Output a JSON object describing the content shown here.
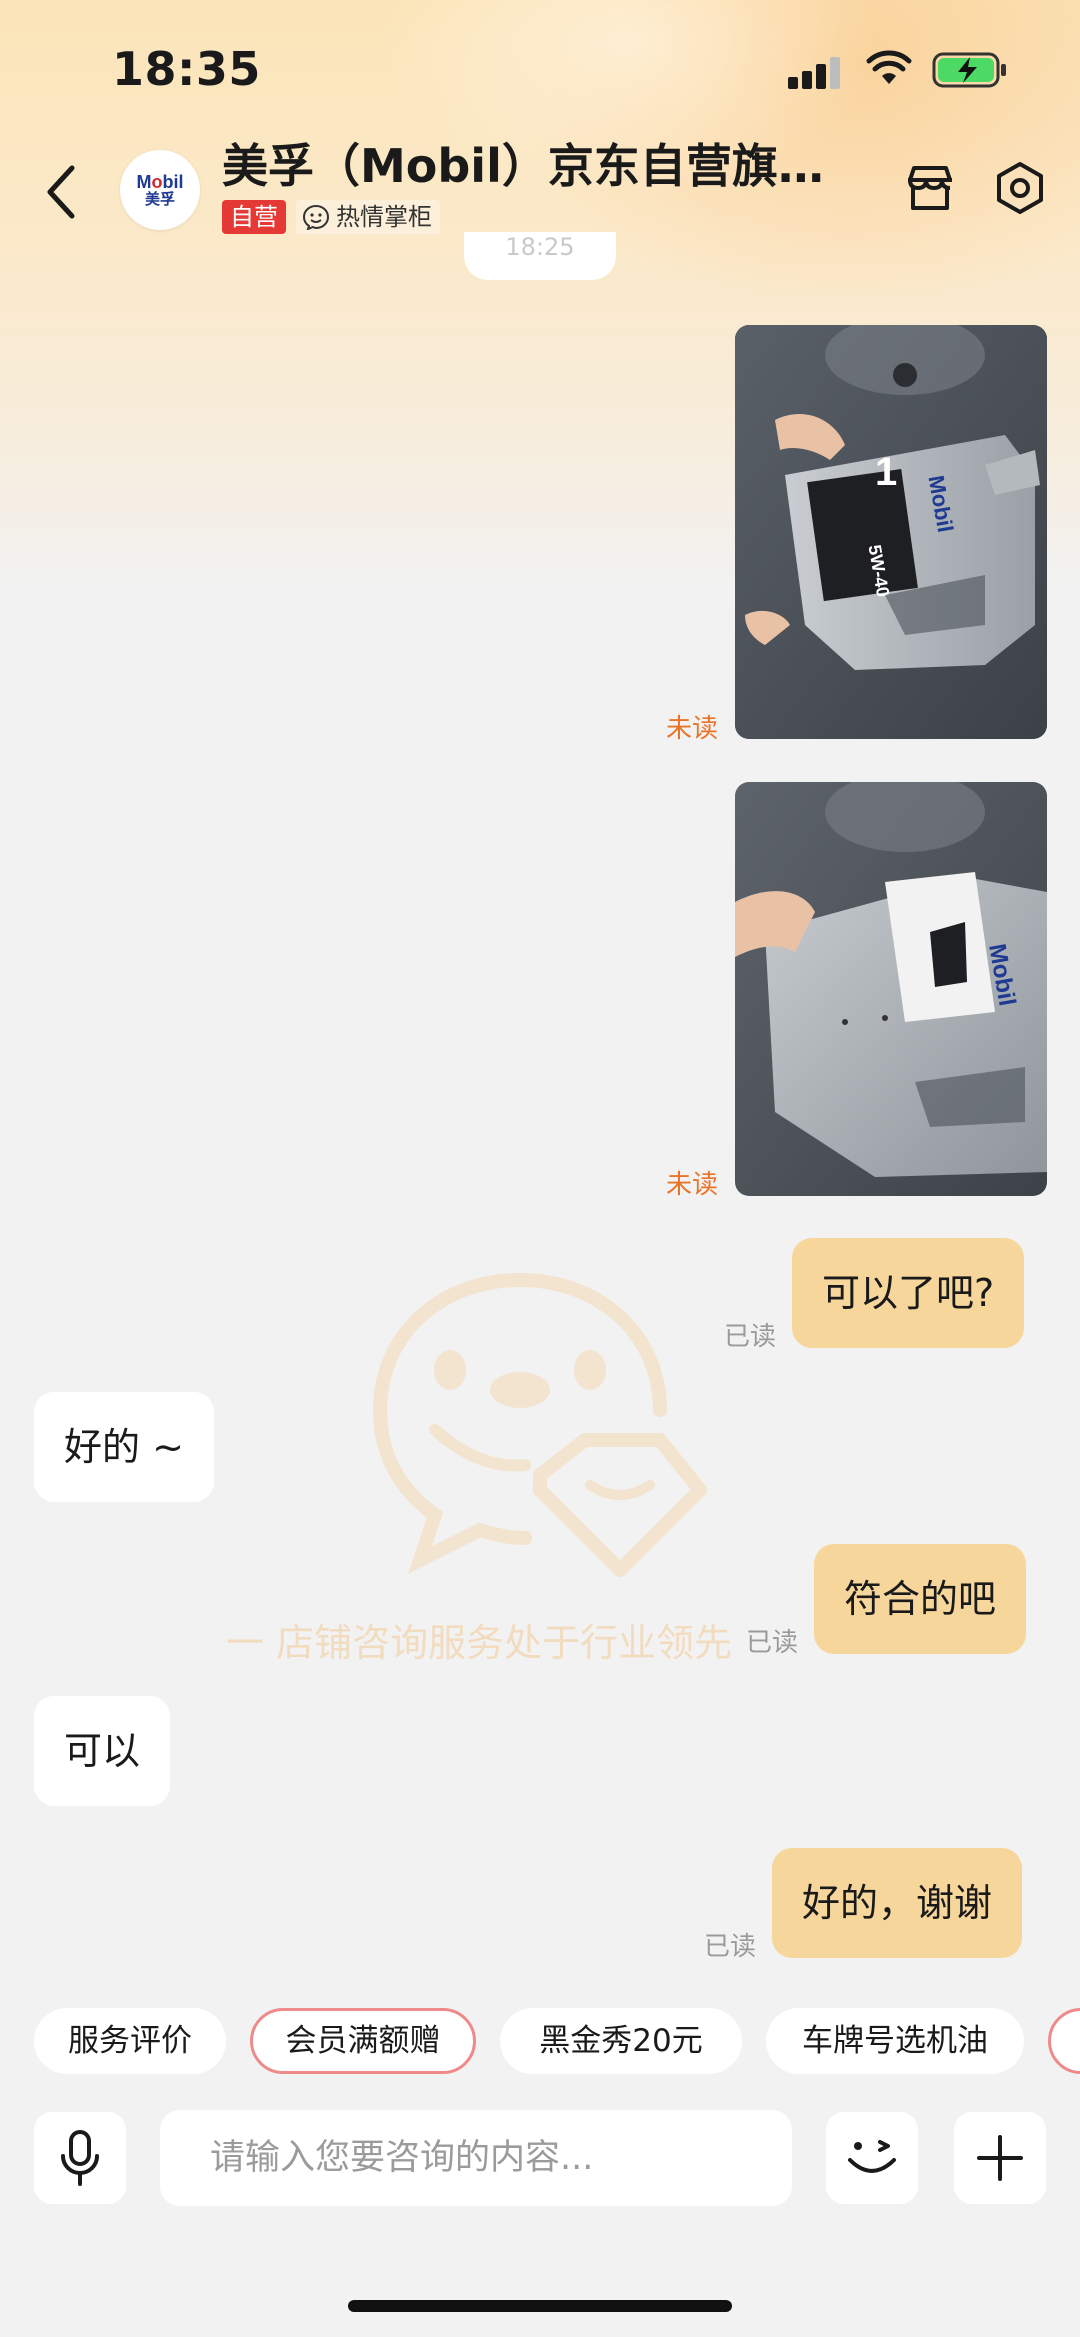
{
  "status_bar": {
    "time": "18:35"
  },
  "header": {
    "avatar_logo_line1_a": "M",
    "avatar_logo_line1_b": "o",
    "avatar_logo_line1_c": "bil",
    "avatar_logo_line2": "美孚",
    "shop_title": "美孚（Mobil）京东自营旗…",
    "tag_self": "自营",
    "tag_host": "热情掌柜"
  },
  "chat": {
    "time_chip": "18:25",
    "messages": [
      {
        "type": "image",
        "side": "out",
        "status": "未读",
        "alt": "Mobil 1 5W-40 bottle photo"
      },
      {
        "type": "image",
        "side": "out",
        "status": "未读",
        "alt": "Mobil bottle side photo"
      },
      {
        "type": "text",
        "side": "out",
        "text": "可以了吧?",
        "status": "已读"
      },
      {
        "type": "text",
        "side": "in",
        "text": "好的 ~"
      },
      {
        "type": "text",
        "side": "out",
        "text": "符合的吧",
        "status": "已读"
      },
      {
        "type": "text",
        "side": "in",
        "text": "可以"
      },
      {
        "type": "text",
        "side": "out",
        "text": "好的，谢谢",
        "status": "已读"
      }
    ]
  },
  "watermark": {
    "text": "一  店铺咨询服务处于行业领先"
  },
  "quick_replies": [
    "服务评价",
    "会员满额赠",
    "黑金秀20元",
    "车牌号选机油"
  ],
  "input": {
    "placeholder": "请输入您要咨询的内容..."
  },
  "colors": {
    "bubble_out": "#f7d69b",
    "unread": "#e8742a",
    "tag_self": "#e53935"
  },
  "photo_labels": {
    "brand": "Mobil",
    "number": "1",
    "grade": "5W-40"
  }
}
